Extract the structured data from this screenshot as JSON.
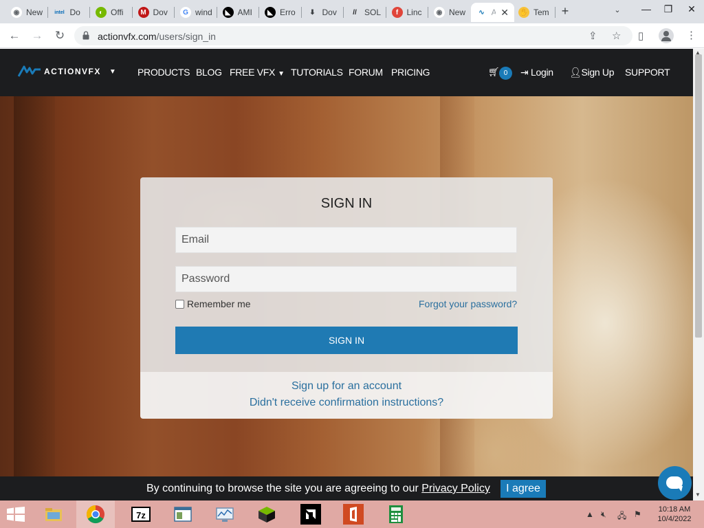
{
  "browser": {
    "tabs": [
      {
        "title": "New",
        "favicon": "chrome-icon"
      },
      {
        "title": "Do",
        "favicon": "intel-icon"
      },
      {
        "title": "Offi",
        "favicon": "nvidia-icon"
      },
      {
        "title": "Dov",
        "favicon": "mcafee-icon"
      },
      {
        "title": "wind",
        "favicon": "google-icon"
      },
      {
        "title": "AMI",
        "favicon": "amd-icon"
      },
      {
        "title": "Erro",
        "favicon": "app-icon"
      },
      {
        "title": "Dov",
        "favicon": "download-icon"
      },
      {
        "title": "SOL",
        "favicon": "slash-icon"
      },
      {
        "title": "Linc",
        "favicon": "facebook-icon"
      },
      {
        "title": "New",
        "favicon": "chrome-icon"
      },
      {
        "title": "A",
        "favicon": "actionvfx-icon",
        "active": true
      },
      {
        "title": "Tem",
        "favicon": "hand-icon"
      }
    ],
    "address": {
      "host": "actionvfx.com",
      "path": "/users/sign_in"
    }
  },
  "site": {
    "logo_text": "ACTIONVFX",
    "nav": {
      "products": "PRODUCTS",
      "blog": "BLOG",
      "free_vfx": "FREE VFX",
      "tutorials": "TUTORIALS",
      "forum": "FORUM",
      "pricing": "PRICING"
    },
    "cart_count": "0",
    "login": "Login",
    "signup": "Sign Up",
    "support": "SUPPORT",
    "accent": "#1a7bb8"
  },
  "signin": {
    "title": "SIGN IN",
    "email_placeholder": "Email",
    "password_placeholder": "Password",
    "remember_label": "Remember me",
    "forgot_link": "Forgot your password?",
    "submit_label": "SIGN IN",
    "signup_link": "Sign up for an account",
    "confirm_link": "Didn't receive confirmation instructions?"
  },
  "cookie_banner": {
    "message": "By continuing to browse the site you are agreeing to our",
    "policy_link": "Privacy Policy",
    "agree_label": "I agree"
  },
  "taskbar": {
    "time": "10:18 AM",
    "date": "10/4/2022"
  }
}
